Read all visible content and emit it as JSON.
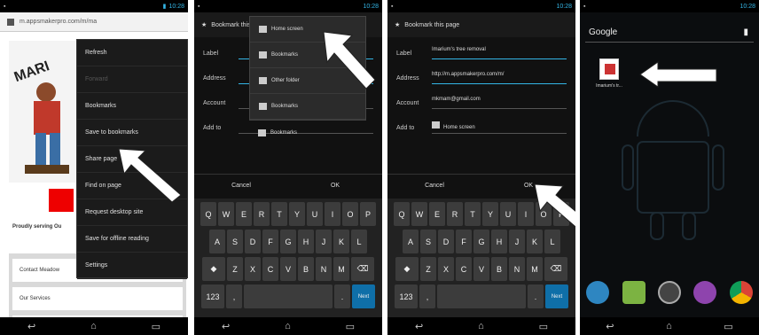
{
  "panel1": {
    "url": "m.appsmakerpro.com/m/ma",
    "menu_items": [
      "Refresh",
      "Forward",
      "Bookmarks",
      "Save to bookmarks",
      "Share page",
      "Find on page",
      "Request desktop site",
      "Save for offline reading",
      "Settings"
    ],
    "page_text": "Proudly serving Ou",
    "list_items": [
      "Contact Meadow",
      "Our Services",
      ""
    ],
    "logo_text": "MARI"
  },
  "panel2": {
    "title": "Bookmark this page",
    "labels": [
      "Label",
      "Address",
      "Account",
      "Add to"
    ],
    "dropdown": [
      "Home screen",
      "Bookmarks",
      "Other folder",
      "Bookmarks",
      "Bookmarks"
    ],
    "buttons": [
      "Cancel",
      "OK"
    ]
  },
  "panel3": {
    "title": "Bookmark this page",
    "labels": [
      "Label",
      "Address",
      "Account",
      "Add to"
    ],
    "values": [
      "Imarium's tree removal",
      "http://m.appsmakerpro.com/m/",
      "mkmam@gmail.com",
      "Home screen"
    ],
    "buttons": [
      "Cancel",
      "OK"
    ]
  },
  "keyboard": {
    "row1": [
      "Q",
      "W",
      "E",
      "R",
      "T",
      "Y",
      "U",
      "I",
      "O",
      "P"
    ],
    "row2": [
      "A",
      "S",
      "D",
      "F",
      "G",
      "H",
      "J",
      "K",
      "L"
    ],
    "row3": [
      "Z",
      "X",
      "C",
      "V",
      "B",
      "N",
      "M"
    ],
    "row4_left": "123",
    "row4_comma": ",",
    "row4_dot": ".",
    "next": "Next"
  },
  "panel4": {
    "search": "Google",
    "app_label": "Imarium's tr..."
  },
  "status_time": "10:28"
}
